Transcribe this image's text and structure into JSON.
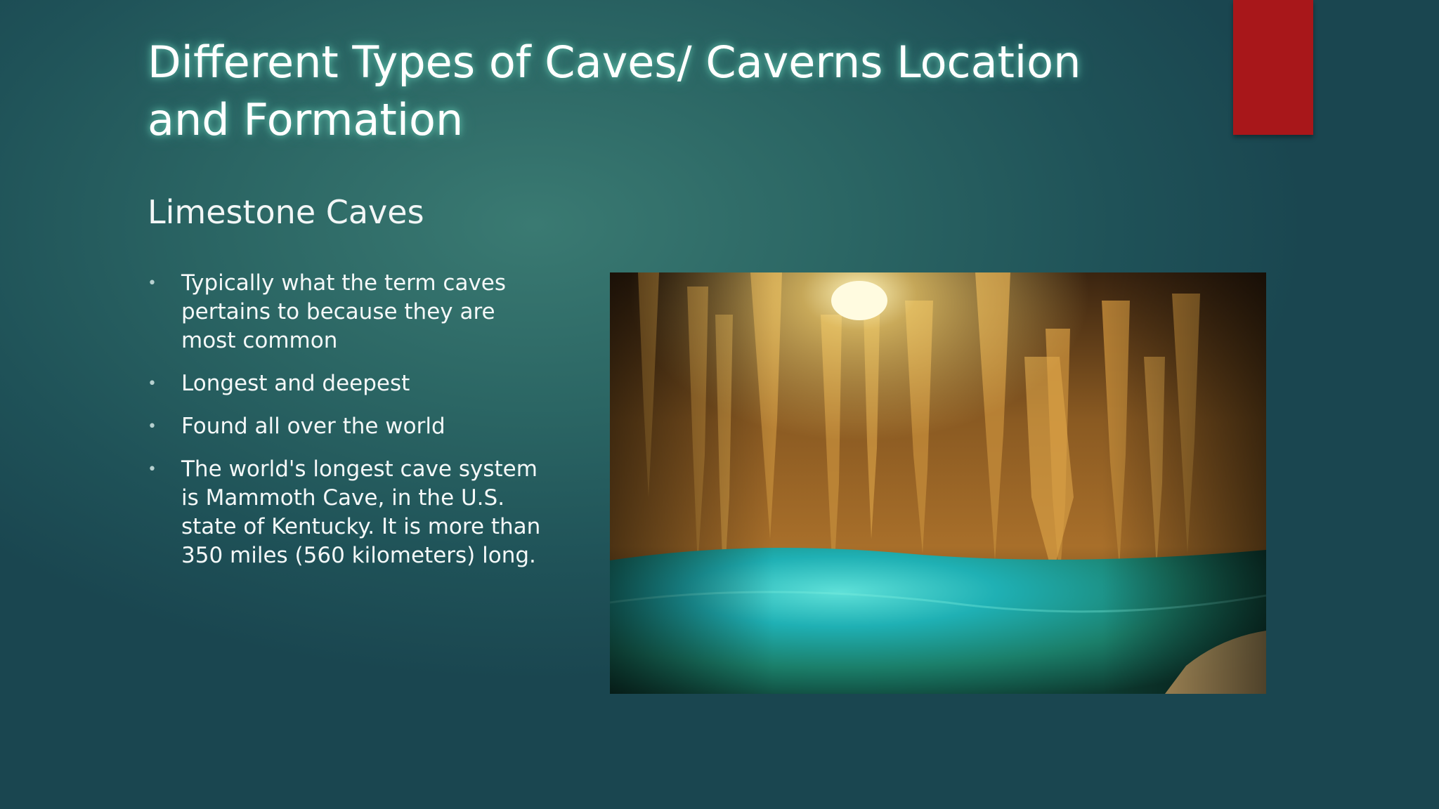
{
  "slide": {
    "title": "Different Types of Caves/ Caverns Location and Formation",
    "subtitle": "Limestone Caves",
    "bullets": [
      "Typically what the term caves pertains to because they are most common",
      "Longest and deepest",
      "Found all over the world",
      "The world's longest cave system is Mammoth Cave, in the U.S. state of Kentucky. It is more than 350 miles (560 kilometers) long."
    ],
    "bullet_marker": "•",
    "image_icon": "cave-photo",
    "colors": {
      "background": "#1f5258",
      "accent": "#a8171a",
      "text": "#ffffff"
    }
  }
}
